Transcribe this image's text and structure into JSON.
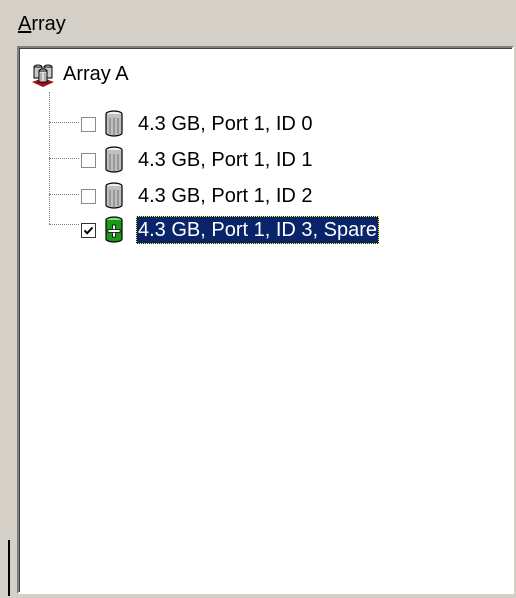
{
  "group": {
    "label_accel": "A",
    "label_rest": "rray"
  },
  "tree": {
    "root": {
      "label": "Array A",
      "icon": "array-icon"
    },
    "children": [
      {
        "label": "4.3 GB, Port 1, ID 0",
        "checked": false,
        "icon": "disk-icon",
        "selected": false
      },
      {
        "label": "4.3 GB, Port 1, ID 1",
        "checked": false,
        "icon": "disk-icon",
        "selected": false
      },
      {
        "label": "4.3 GB, Port 1, ID 2",
        "checked": false,
        "icon": "disk-icon",
        "selected": false
      },
      {
        "label": "4.3 GB, Port 1, ID 3, Spare",
        "checked": true,
        "icon": "spare-disk-icon",
        "selected": true
      }
    ]
  },
  "colors": {
    "panel": "#d4d0c8",
    "selection": "#0a246a",
    "spare_disk": "#1a9a1a"
  }
}
